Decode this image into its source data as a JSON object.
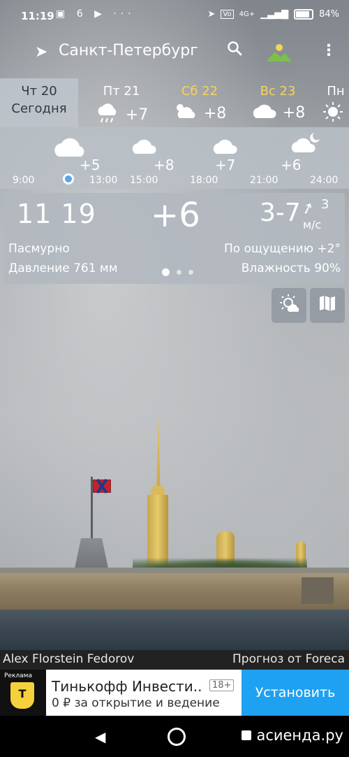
{
  "status_bar": {
    "time": "11:19",
    "left_icons": [
      "message-icon",
      "6",
      "play-icon",
      "more-dots"
    ],
    "notif_six": "6",
    "network": "4G+",
    "battery": "84%"
  },
  "app_bar": {
    "city": "Санкт-Петербург"
  },
  "days": [
    {
      "name": "Чт 20",
      "sub": "Сегодня",
      "active": true
    },
    {
      "name": "Пт 21",
      "temp": "+7",
      "icon": "rain-cloud-icon"
    },
    {
      "name": "Сб 22",
      "temp": "+8",
      "icon": "partly-cloudy-icon",
      "weekend": true
    },
    {
      "name": "Вс 23",
      "temp": "+8",
      "icon": "cloud-icon",
      "weekend": true
    },
    {
      "name": "Пн",
      "icon": "sun-icon"
    }
  ],
  "hourly": {
    "temps": [
      "+5",
      "+8",
      "+7",
      "+6"
    ],
    "times": [
      "9:00",
      "13:00",
      "15:00",
      "18:00",
      "21:00",
      "24:00"
    ]
  },
  "current": {
    "clock": "11 19",
    "temp": "+6",
    "wind": "3-7",
    "wind_speed": "3",
    "wind_unit": "м/с",
    "condition": "Пасмурно",
    "feels_like": "По ощущению +2°",
    "pressure": "Давление 761 мм",
    "humidity": "Влажность 90%"
  },
  "credits": {
    "author": "Alex Florstein Fedorov",
    "source": "Прогноз от Foreca"
  },
  "ad": {
    "tag": "Реклама",
    "title": "Тинькофф Инвести..",
    "age": "18+",
    "subtitle": "0 ₽ за открытие и ведение",
    "button": "Установить"
  },
  "watermark": "асиенда.ру"
}
